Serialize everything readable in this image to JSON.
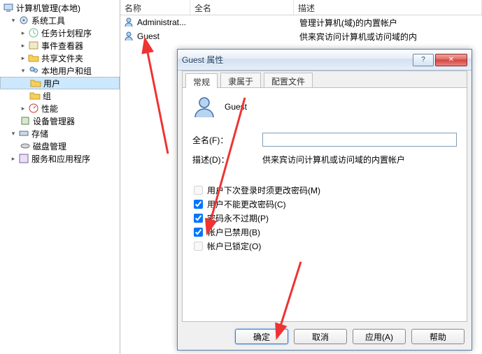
{
  "tree": {
    "root": "计算机管理(本地)",
    "sys_tools": "系统工具",
    "task": "任务计划程序",
    "event": "事件查看器",
    "shared": "共享文件夹",
    "local_users": "本地用户和组",
    "users": "用户",
    "groups": "组",
    "perf": "性能",
    "devmgr": "设备管理器",
    "storage": "存储",
    "diskmgmt": "磁盘管理",
    "services": "服务和应用程序"
  },
  "list": {
    "headers": {
      "name": "名称",
      "full": "全名",
      "desc": "描述"
    },
    "rows": [
      {
        "name": "Administrat...",
        "full": "",
        "desc": "管理计算机(域)的内置帐户"
      },
      {
        "name": "Guest",
        "full": "",
        "desc": "供来宾访问计算机或访问域的内"
      }
    ]
  },
  "dialog": {
    "title": "Guest 属性",
    "tabs": {
      "general": "常规",
      "memberof": "隶属于",
      "profile": "配置文件"
    },
    "username": "Guest",
    "fullname_label": "全名(F)：",
    "fullname_value": "",
    "desc_label": "描述(D)：",
    "desc_value": "供来宾访问计算机或访问域的内置帐户",
    "chk_change_next": "用户下次登录时须更改密码(M)",
    "chk_cannot_change": "用户不能更改密码(C)",
    "chk_never_expire": "密码永不过期(P)",
    "chk_disabled": "帐户已禁用(B)",
    "chk_locked": "帐户已锁定(O)",
    "buttons": {
      "ok": "确定",
      "cancel": "取消",
      "apply": "应用(A)",
      "help": "帮助"
    }
  }
}
